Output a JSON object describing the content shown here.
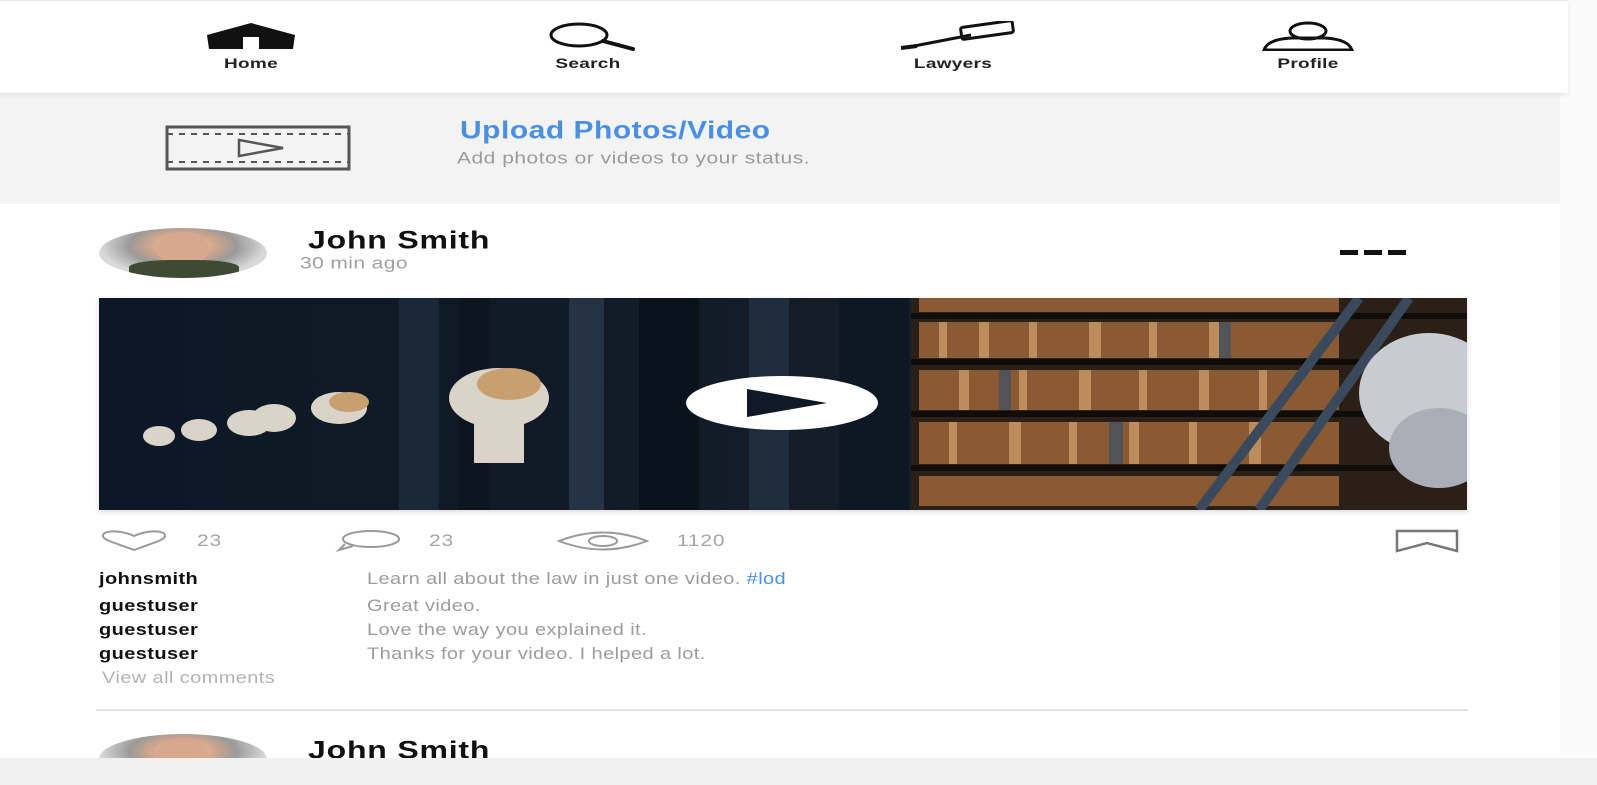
{
  "nav": {
    "items": [
      {
        "label": "Home",
        "icon": "home-icon"
      },
      {
        "label": "Search",
        "icon": "search-icon"
      },
      {
        "label": "Lawyers",
        "icon": "gavel-icon"
      },
      {
        "label": "Profile",
        "icon": "user-icon"
      }
    ]
  },
  "upload": {
    "title": "Upload Photos/Video",
    "subtitle": "Add photos or videos to your status.",
    "icon": "video-film-icon"
  },
  "posts": [
    {
      "author": "John Smith",
      "time": "30 min ago",
      "media_icon": "play-icon",
      "stats": {
        "likes": "23",
        "comments": "23",
        "views": "1120"
      },
      "caption": {
        "user": "johnsmith",
        "text": "Learn all about the law in just one video. ",
        "hashtag": "#lod"
      },
      "comments": [
        {
          "user": "guestuser",
          "text": "Great video."
        },
        {
          "user": "guestuser",
          "text": "Love the way you explained it."
        },
        {
          "user": "guestuser",
          "text": "Thanks for your video. I helped a lot."
        }
      ],
      "view_all": "View all comments"
    },
    {
      "author": "John Smith"
    }
  ],
  "colors": {
    "accent": "#4a90e2",
    "muted_text": "#9c9c9c",
    "upload_bg": "#f3f3f3"
  }
}
